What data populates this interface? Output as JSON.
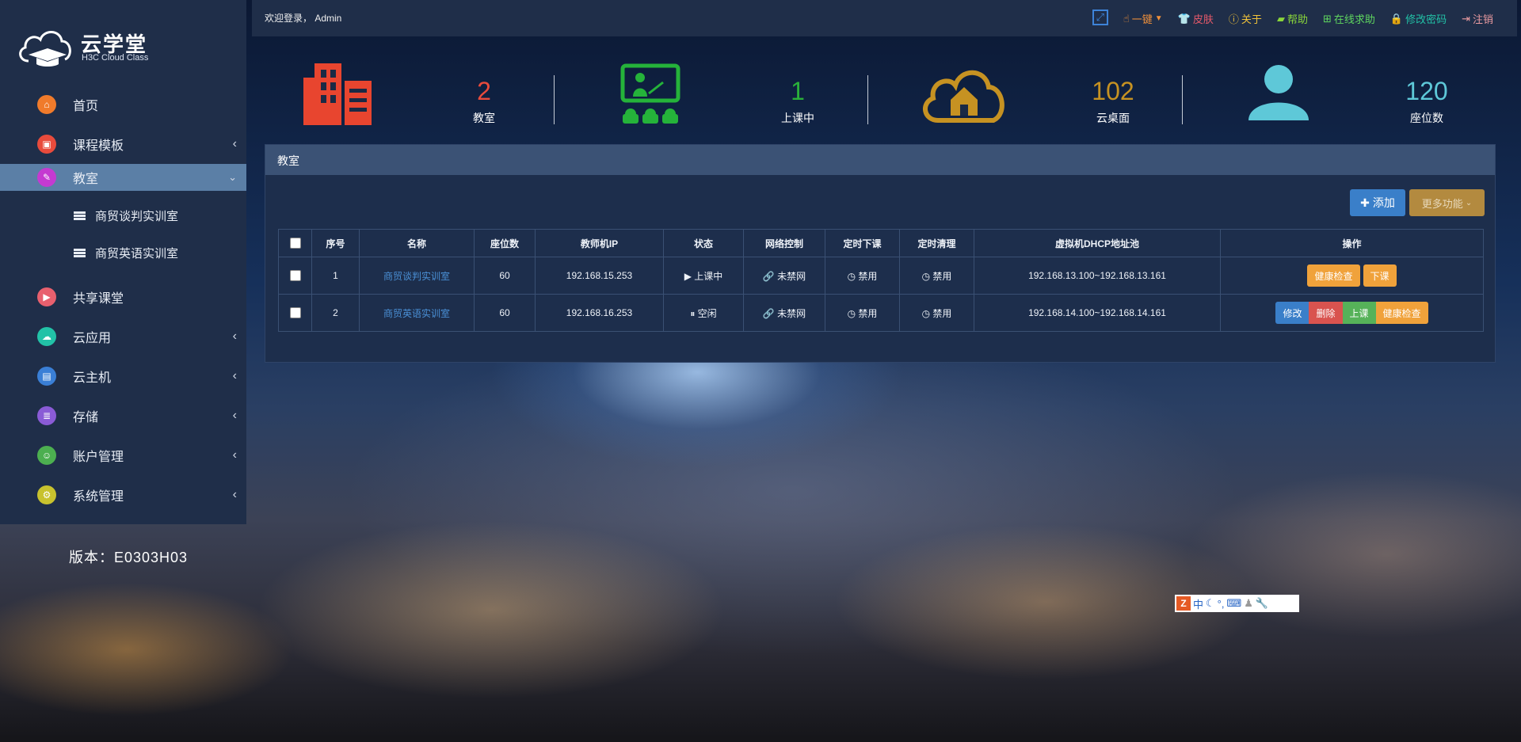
{
  "brand": {
    "title": "云学堂",
    "subtitle": "H3C Cloud Class"
  },
  "sidebar": {
    "items": [
      {
        "label": "首页",
        "color": "#f07b2b",
        "icon": "home-icon"
      },
      {
        "label": "课程模板",
        "color": "#e84b3c",
        "icon": "template-icon"
      },
      {
        "label": "教室",
        "color": "#c53ad1",
        "icon": "classroom-icon"
      },
      {
        "label": "共享课堂",
        "color": "#e8606e",
        "icon": "share-class-icon"
      },
      {
        "label": "云应用",
        "color": "#22c2a7",
        "icon": "cloud-app-icon"
      },
      {
        "label": "云主机",
        "color": "#3a7fd6",
        "icon": "cloud-host-icon"
      },
      {
        "label": "存储",
        "color": "#8a5bd6",
        "icon": "storage-icon"
      },
      {
        "label": "账户管理",
        "color": "#4caf50",
        "icon": "account-icon"
      },
      {
        "label": "系统管理",
        "color": "#c8c22e",
        "icon": "system-icon"
      }
    ],
    "subitems": [
      "商贸谈判实训室",
      "商贸英语实训室"
    ]
  },
  "version": "版本：E0303H03",
  "topbar": {
    "welcome": "欢迎登录，  Admin",
    "actions": [
      {
        "label": "一键",
        "color": "#f0903a",
        "icon": "hand-pointer-icon"
      },
      {
        "label": "皮肤",
        "color": "#e85a6a",
        "icon": "shirt-icon"
      },
      {
        "label": "关于",
        "color": "#f0c23a",
        "icon": "question-circle-icon"
      },
      {
        "label": "帮助",
        "color": "#8ad63a",
        "icon": "book-icon"
      },
      {
        "label": "在线求助",
        "color": "#5fd65f",
        "icon": "medkit-icon"
      },
      {
        "label": "修改密码",
        "color": "#22c2a7",
        "icon": "lock-icon"
      },
      {
        "label": "注销",
        "color": "#e89aa0",
        "icon": "sign-out-icon"
      }
    ]
  },
  "stats": [
    {
      "value": "2",
      "label": "教室",
      "color": "#e84b3c"
    },
    {
      "value": "1",
      "label": "上课中",
      "color": "#2ab03a"
    },
    {
      "value": "102",
      "label": "云桌面",
      "color": "#c69222"
    },
    {
      "value": "120",
      "label": "座位数",
      "color": "#5ec8d8"
    }
  ],
  "panel": {
    "title": "教室",
    "add_label": "添加",
    "more_label": "更多功能",
    "columns": [
      "序号",
      "名称",
      "座位数",
      "教师机IP",
      "状态",
      "网络控制",
      "定时下课",
      "定时清理",
      "虚拟机DHCP地址池",
      "操作"
    ],
    "rows": [
      {
        "index": "1",
        "name": "商贸谈判实训室",
        "seats": "60",
        "ip": "192.168.15.253",
        "status": "上课中",
        "network": "未禁网",
        "timed_end": "禁用",
        "timed_clean": "禁用",
        "dhcp": "192.168.13.100~192.168.13.161",
        "ops": [
          "健康检查",
          "下课"
        ]
      },
      {
        "index": "2",
        "name": "商贸英语实训室",
        "seats": "60",
        "ip": "192.168.16.253",
        "status": "空闲",
        "network": "未禁网",
        "timed_end": "禁用",
        "timed_clean": "禁用",
        "dhcp": "192.168.14.100~192.168.14.161",
        "ops": [
          "修改",
          "删除",
          "上课",
          "健康检查"
        ]
      }
    ]
  },
  "ime": {
    "mode": "中"
  }
}
